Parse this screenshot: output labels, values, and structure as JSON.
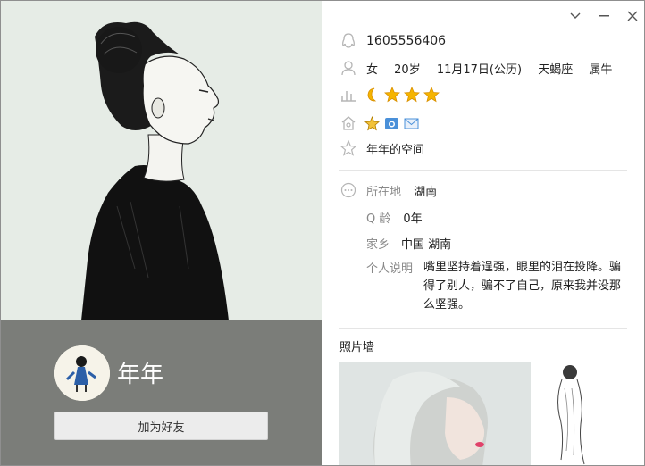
{
  "window": {
    "minimize_label": "minimize",
    "close_label": "close"
  },
  "profile": {
    "nickname": "年年",
    "add_friend_label": "加为好友"
  },
  "info": {
    "qq_number": "1605556406",
    "gender": "女",
    "age": "20岁",
    "birthday": "11月17日(公历)",
    "zodiac": "天蝎座",
    "chinese_zodiac": "属牛",
    "space_label": "年年的空间",
    "level_icons": [
      "moon-icon",
      "star-icon",
      "star-icon",
      "star-icon"
    ],
    "service_icons": [
      "crown-icon",
      "camera-icon",
      "mail-icon"
    ]
  },
  "details": {
    "location_label": "所在地",
    "location_value": "湖南",
    "qage_label": "Q 龄",
    "qage_value": "0年",
    "hometown_label": "家乡",
    "hometown_value": "中国  湖南",
    "signature_label": "个人说明",
    "signature_value": "嘴里坚持着逞强，眼里的泪在投降。骗得了别人，骗不了自己，原来我并没那么坚强。"
  },
  "photos": {
    "title": "照片墙"
  },
  "colors": {
    "left_bg": "#7b7d79",
    "cover_bg": "#e6ece6",
    "star": "#f5b400",
    "icon_gray": "#b0b0b0"
  }
}
